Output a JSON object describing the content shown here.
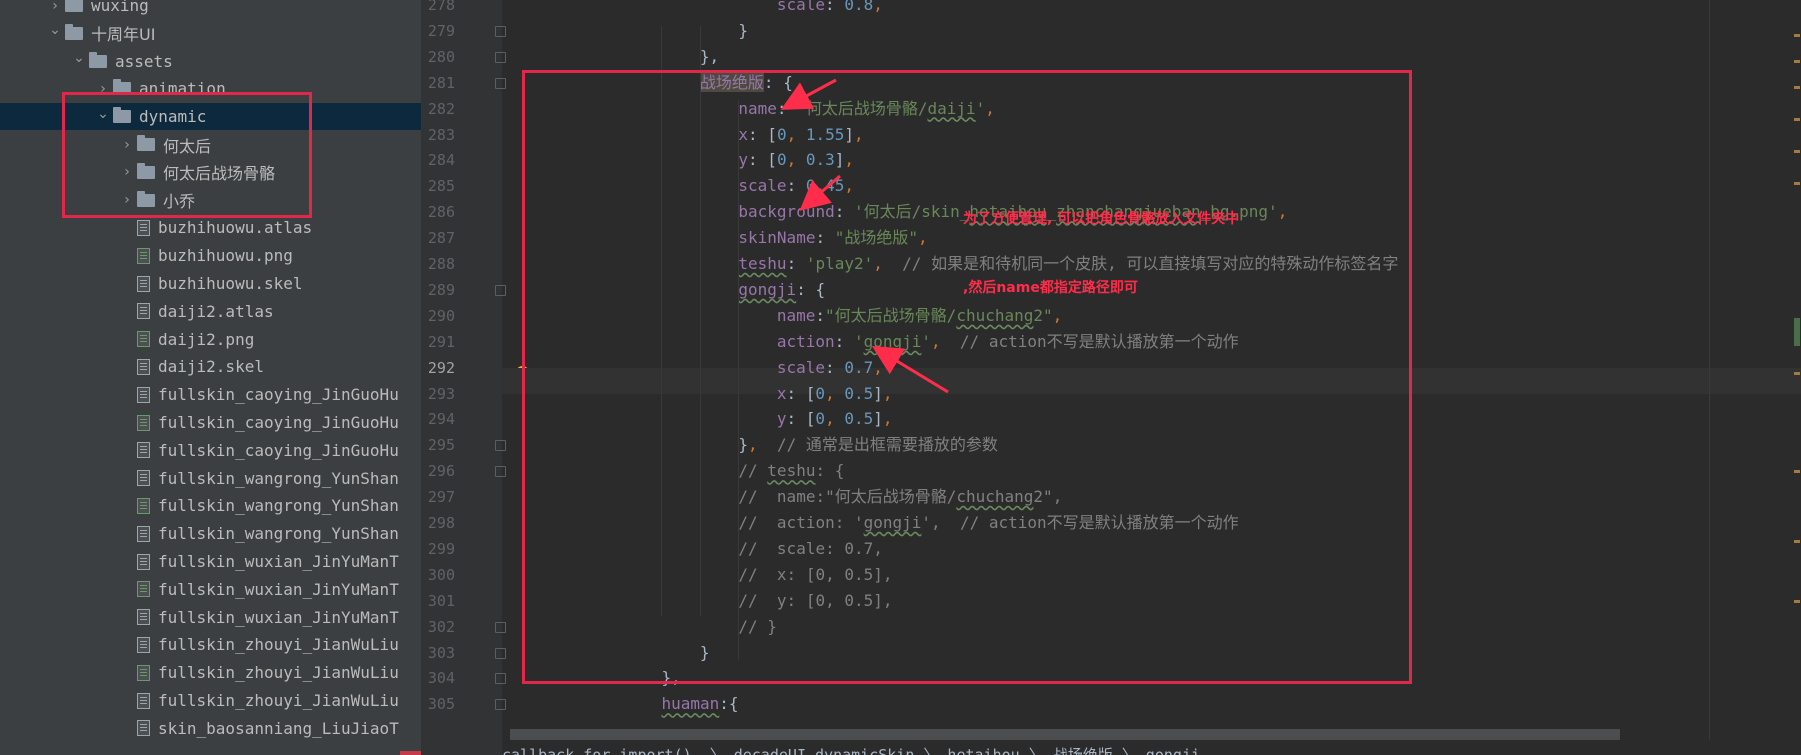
{
  "project_tree": [
    {
      "label": "wuxing",
      "kind": "folder",
      "state": "collapsed",
      "depth": 2
    },
    {
      "label": "十周年UI",
      "kind": "folder",
      "state": "expanded",
      "depth": 2
    },
    {
      "label": "assets",
      "kind": "folder",
      "state": "expanded",
      "depth": 3
    },
    {
      "label": "animation",
      "kind": "folder",
      "state": "collapsed",
      "depth": 4
    },
    {
      "label": "dynamic",
      "kind": "folder",
      "state": "expanded",
      "depth": 4,
      "selected": true
    },
    {
      "label": "何太后",
      "kind": "folder",
      "state": "collapsed",
      "depth": 5
    },
    {
      "label": "何太后战场骨骼",
      "kind": "folder",
      "state": "collapsed",
      "depth": 5
    },
    {
      "label": "小乔",
      "kind": "folder",
      "state": "collapsed",
      "depth": 5
    },
    {
      "label": "buzhihuowu.atlas",
      "kind": "file",
      "depth": 5
    },
    {
      "label": "buzhihuowu.png",
      "kind": "image",
      "depth": 5
    },
    {
      "label": "buzhihuowu.skel",
      "kind": "file",
      "depth": 5
    },
    {
      "label": "daiji2.atlas",
      "kind": "file",
      "depth": 5
    },
    {
      "label": "daiji2.png",
      "kind": "image",
      "depth": 5
    },
    {
      "label": "daiji2.skel",
      "kind": "file",
      "depth": 5
    },
    {
      "label": "fullskin_caoying_JinGuoHu",
      "kind": "file",
      "depth": 5
    },
    {
      "label": "fullskin_caoying_JinGuoHu",
      "kind": "image",
      "depth": 5
    },
    {
      "label": "fullskin_caoying_JinGuoHu",
      "kind": "file",
      "depth": 5
    },
    {
      "label": "fullskin_wangrong_YunShan",
      "kind": "file",
      "depth": 5
    },
    {
      "label": "fullskin_wangrong_YunShan",
      "kind": "image",
      "depth": 5
    },
    {
      "label": "fullskin_wangrong_YunShan",
      "kind": "file",
      "depth": 5
    },
    {
      "label": "fullskin_wuxian_JinYuManT",
      "kind": "file",
      "depth": 5
    },
    {
      "label": "fullskin_wuxian_JinYuManT",
      "kind": "image",
      "depth": 5
    },
    {
      "label": "fullskin_wuxian_JinYuManT",
      "kind": "file",
      "depth": 5
    },
    {
      "label": "fullskin_zhouyi_JianWuLiu",
      "kind": "file",
      "depth": 5
    },
    {
      "label": "fullskin_zhouyi_JianWuLiu",
      "kind": "image",
      "depth": 5
    },
    {
      "label": "fullskin_zhouyi_JianWuLiu",
      "kind": "file",
      "depth": 5
    },
    {
      "label": "skin_baosanniang_LiuJiaoT",
      "kind": "file",
      "depth": 5
    }
  ],
  "editor": {
    "current_line": 292,
    "lines": [
      {
        "no": "278",
        "indent": 2,
        "tokens": [
          {
            "t": "scale",
            "c": "k"
          },
          {
            "t": ": "
          },
          {
            "t": "0.8",
            "c": "n"
          },
          {
            "t": ",",
            "c": "p"
          }
        ]
      },
      {
        "no": "279",
        "indent": 1,
        "tokens": [
          {
            "t": "}"
          }
        ]
      },
      {
        "no": "280",
        "indent": 0,
        "tokens": [
          {
            "t": "},"
          }
        ]
      },
      {
        "no": "281",
        "indent": 0,
        "tokens": [
          {
            "t": "战场绝版",
            "c": "hl"
          },
          {
            "t": ": {"
          }
        ]
      },
      {
        "no": "282",
        "indent": 1,
        "tokens": [
          {
            "t": "name",
            "c": "k"
          },
          {
            "t": ": "
          },
          {
            "t": "'何太后战场骨骼/",
            "c": "s"
          },
          {
            "t": "daiji",
            "c": "s u"
          },
          {
            "t": "'",
            "c": "s"
          },
          {
            "t": ",",
            "c": "p"
          }
        ]
      },
      {
        "no": "283",
        "indent": 1,
        "tokens": [
          {
            "t": "x",
            "c": "k"
          },
          {
            "t": ": ["
          },
          {
            "t": "0",
            "c": "n"
          },
          {
            "t": ", ",
            "c": "p"
          },
          {
            "t": "1.55",
            "c": "n"
          },
          {
            "t": "]"
          },
          {
            "t": ",",
            "c": "p"
          }
        ]
      },
      {
        "no": "284",
        "indent": 1,
        "tokens": [
          {
            "t": "y",
            "c": "k"
          },
          {
            "t": ": ["
          },
          {
            "t": "0",
            "c": "n"
          },
          {
            "t": ", ",
            "c": "p"
          },
          {
            "t": "0.3",
            "c": "n"
          },
          {
            "t": "]"
          },
          {
            "t": ",",
            "c": "p"
          }
        ]
      },
      {
        "no": "285",
        "indent": 1,
        "tokens": [
          {
            "t": "scale",
            "c": "k"
          },
          {
            "t": ": "
          },
          {
            "t": "0.45",
            "c": "n"
          },
          {
            "t": ",",
            "c": "p"
          }
        ]
      },
      {
        "no": "286",
        "indent": 1,
        "tokens": [
          {
            "t": "background",
            "c": "k"
          },
          {
            "t": ": "
          },
          {
            "t": "'何太后/skin_",
            "c": "s"
          },
          {
            "t": "hetaihou",
            "c": "s u"
          },
          {
            "t": "_",
            "c": "s"
          },
          {
            "t": "zhanchangjueban",
            "c": "s u"
          },
          {
            "t": "_bg.png'",
            "c": "s"
          },
          {
            "t": ",",
            "c": "p"
          }
        ]
      },
      {
        "no": "287",
        "indent": 1,
        "tokens": [
          {
            "t": "skinName",
            "c": "k"
          },
          {
            "t": ": "
          },
          {
            "t": "\"战场绝版\"",
            "c": "s"
          },
          {
            "t": ",",
            "c": "p"
          }
        ]
      },
      {
        "no": "288",
        "indent": 1,
        "tokens": [
          {
            "t": "teshu",
            "c": "k u"
          },
          {
            "t": ": "
          },
          {
            "t": "'play2'",
            "c": "s"
          },
          {
            "t": ",",
            "c": "p"
          },
          {
            "t": "  // 如果是和待机同一个皮肤, 可以直接填写对应的特殊动作标签名字",
            "c": "c"
          }
        ]
      },
      {
        "no": "289",
        "indent": 1,
        "tokens": [
          {
            "t": "gongji",
            "c": "k u"
          },
          {
            "t": ": {"
          }
        ]
      },
      {
        "no": "290",
        "indent": 2,
        "tokens": [
          {
            "t": "name",
            "c": "k"
          },
          {
            "t": ":"
          },
          {
            "t": "\"何太后战场骨骼/",
            "c": "s"
          },
          {
            "t": "chuchang",
            "c": "s u"
          },
          {
            "t": "2\"",
            "c": "s"
          },
          {
            "t": ",",
            "c": "p"
          }
        ]
      },
      {
        "no": "291",
        "indent": 2,
        "tokens": [
          {
            "t": "action",
            "c": "k"
          },
          {
            "t": ": "
          },
          {
            "t": "'",
            "c": "s"
          },
          {
            "t": "gongji",
            "c": "s u"
          },
          {
            "t": "'",
            "c": "s"
          },
          {
            "t": ",",
            "c": "p"
          },
          {
            "t": "  // action不写是默认播放第一个动作",
            "c": "c"
          }
        ]
      },
      {
        "no": "292",
        "indent": 2,
        "tokens": [
          {
            "t": "scale",
            "c": "k"
          },
          {
            "t": ": "
          },
          {
            "t": "0.7",
            "c": "n"
          },
          {
            "t": ",",
            "c": "p"
          }
        ]
      },
      {
        "no": "293",
        "indent": 2,
        "tokens": [
          {
            "t": "x",
            "c": "k"
          },
          {
            "t": ": ["
          },
          {
            "t": "0",
            "c": "n"
          },
          {
            "t": ", ",
            "c": "p"
          },
          {
            "t": "0.5",
            "c": "n"
          },
          {
            "t": "]"
          },
          {
            "t": ",",
            "c": "p"
          }
        ]
      },
      {
        "no": "294",
        "indent": 2,
        "tokens": [
          {
            "t": "y",
            "c": "k"
          },
          {
            "t": ": ["
          },
          {
            "t": "0",
            "c": "n"
          },
          {
            "t": ", ",
            "c": "p"
          },
          {
            "t": "0.5",
            "c": "n"
          },
          {
            "t": "]"
          },
          {
            "t": ",",
            "c": "p"
          }
        ]
      },
      {
        "no": "295",
        "indent": 1,
        "tokens": [
          {
            "t": "}"
          },
          {
            "t": ",",
            "c": "p"
          },
          {
            "t": "  // 通常是出框需要播放的参数",
            "c": "c"
          }
        ]
      },
      {
        "no": "296",
        "indent": 1,
        "tokens": [
          {
            "t": "// ",
            "c": "c"
          },
          {
            "t": "teshu",
            "c": "c u"
          },
          {
            "t": ": {",
            "c": "c"
          }
        ]
      },
      {
        "no": "297",
        "indent": 1,
        "tokens": [
          {
            "t": "//  name:\"何太后战场骨骼/",
            "c": "c"
          },
          {
            "t": "chuchang",
            "c": "c u"
          },
          {
            "t": "2\",",
            "c": "c"
          }
        ]
      },
      {
        "no": "298",
        "indent": 1,
        "tokens": [
          {
            "t": "//  action: '",
            "c": "c"
          },
          {
            "t": "gongji",
            "c": "c u"
          },
          {
            "t": "',  // action不写是默认播放第一个动作",
            "c": "c"
          }
        ]
      },
      {
        "no": "299",
        "indent": 1,
        "tokens": [
          {
            "t": "//  scale: 0.7,",
            "c": "c"
          }
        ]
      },
      {
        "no": "300",
        "indent": 1,
        "tokens": [
          {
            "t": "//  x: [0, 0.5],",
            "c": "c"
          }
        ]
      },
      {
        "no": "301",
        "indent": 1,
        "tokens": [
          {
            "t": "//  y: [0, 0.5],",
            "c": "c"
          }
        ]
      },
      {
        "no": "302",
        "indent": 1,
        "tokens": [
          {
            "t": "// }",
            "c": "c"
          }
        ]
      },
      {
        "no": "303",
        "indent": 0,
        "tokens": [
          {
            "t": "}"
          }
        ]
      },
      {
        "no": "304",
        "indent": -1,
        "tokens": [
          {
            "t": "},"
          }
        ]
      },
      {
        "no": "305",
        "indent": -1,
        "tokens": [
          {
            "t": "huaman",
            "c": "k u"
          },
          {
            "t": ":{"
          }
        ]
      }
    ]
  },
  "annotation": {
    "note_lines": [
      "为了方便管理, 可以把角色骨骼放入文件夹中",
      ",然后name都指定路径即可"
    ],
    "color": "#e0284b"
  },
  "breadcrumb": "callback for import()  〉 decadeUI.dynamicSkin 〉 hetaihou 〉 战场绝版 〉 gongji",
  "colors": {
    "editor_bg": "#2b2b2b",
    "sidebar_bg": "#3c3f41",
    "selection": "#0d293e",
    "keyword_purple": "#9876aa",
    "string_green": "#6a8759",
    "number_blue": "#6897bb",
    "comment_gray": "#808080"
  }
}
